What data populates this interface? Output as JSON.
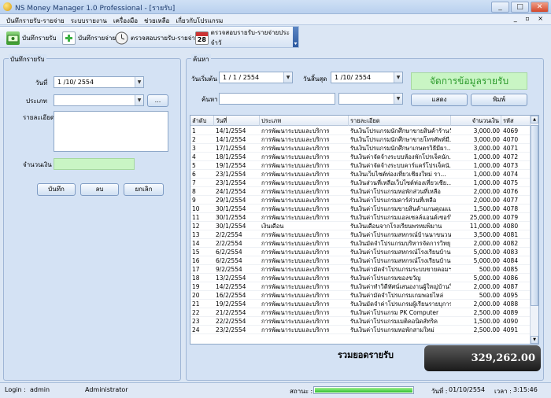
{
  "window": {
    "title": "NS Money Manager 1.0 Professional - [รายรับ]",
    "min": "_",
    "max": "□",
    "close": "✕",
    "mdi_controls": "_ ▫ ×"
  },
  "menu": [
    "บันทึกรายรับ-รายจ่าย",
    "ระบบรายงาน",
    "เครื่องมือ",
    "ช่วยเหลือ",
    "เกี่ยวกับโปรแกรม"
  ],
  "toolbar": {
    "income": "บันทึกรายรับ",
    "expense": "บันทึกรายจ่าย",
    "check": "ตรวจสอบรายรับ-รายจ่าย",
    "check_daily": "ตรวจสอบรายรับ-รายจ่ายประจำวั",
    "calendar_day": "28"
  },
  "left": {
    "panel_title": "บันทึกรายรับ",
    "date_label": "วันที่",
    "date_value": "1 /10/ 2554",
    "type_label": "ประเภท",
    "type_value": "",
    "browse": "...",
    "detail_label": "รายละเอียด",
    "detail_value": "",
    "amount_label": "จำนวนเงิน",
    "amount_value": "",
    "save": "บันทึก",
    "delete": "ลบ",
    "cancel": "ยกเลิก"
  },
  "search": {
    "panel_title": "ค้นหา",
    "start_label": "วันเริ่มต้น",
    "start_value": "1 / 1 / 2554",
    "end_label": "วันสิ้นสุด",
    "end_value": "1 /10/ 2554",
    "manage": "จัดการข้อมูลรายรับ",
    "keyword_label": "ค้นหา",
    "keyword_value": "",
    "filter_value": "",
    "show": "แสดง",
    "print": "พิมพ์"
  },
  "grid": {
    "headers": [
      "ลำดับ",
      "วันที่",
      "ประเภท",
      "รายละเอียด",
      "จำนวนเงิน",
      "รหัส"
    ],
    "rows": [
      [
        "1",
        "14/1/2554",
        "การพัฒนาระบบและบริการ",
        "รับเงินโปรแกรมนักศึกษาขายสินค้าร้านวั...",
        "3,000.00",
        "4069"
      ],
      [
        "2",
        "14/1/2554",
        "การพัฒนาระบบและบริการ",
        "รับเงินโปรแกรมนักศึกษาขายโทรศัพท์มื...",
        "3,000.00",
        "4070"
      ],
      [
        "3",
        "17/1/2554",
        "การพัฒนาระบบและบริการ",
        "รับเงินโปรแกรมนักศึกษาเกษตรวิธีมีผา...",
        "3,000.00",
        "4071"
      ],
      [
        "4",
        "18/1/2554",
        "การพัฒนาระบบและบริการ",
        "รับเงินค่าจัดจ้างระบบห้องพักโปรเจ็คนัก...",
        "1,000.00",
        "4072"
      ],
      [
        "5",
        "19/1/2554",
        "การพัฒนาระบบและบริการ",
        "รับเงินค่าจัดจ้างระบบคาร์แคร์โปรเจ็คนั...",
        "1,000.00",
        "4073"
      ],
      [
        "6",
        "23/1/2554",
        "การพัฒนาระบบและบริการ",
        "รับเงินเว็บไซต์ท่องเที่ยวเชียงใหม่ รา...",
        "1,000.00",
        "4074"
      ],
      [
        "7",
        "23/1/2554",
        "การพัฒนาระบบและบริการ",
        "รับเงินส่วนที่เหลือเว็บไซต์ท่องเที่ยวเชีย...",
        "1,000.00",
        "4075"
      ],
      [
        "8",
        "24/1/2554",
        "การพัฒนาระบบและบริการ",
        "รับเงินค่าโปรแกรมหอพักส่วนที่เหลือ",
        "2,000.00",
        "4076"
      ],
      [
        "9",
        "29/1/2554",
        "การพัฒนาระบบและบริการ",
        "รับเงินค่าโปรแกรมคาร์ส่วนที่เหลือ",
        "2,000.00",
        "4077"
      ],
      [
        "10",
        "30/1/2554",
        "การพัฒนาระบบและบริการ",
        "รับเงินค่าโปรแกรมขายสินค้าแกนคุณแม่...",
        "1,500.00",
        "4078"
      ],
      [
        "11",
        "30/1/2554",
        "การพัฒนาระบบและบริการ",
        "รับเงินค่าโปรแกรมแอลเซลล์แอนด์เซอร์วิส",
        "25,000.00",
        "4079"
      ],
      [
        "12",
        "30/1/2554",
        "เงินเดือน",
        "รับเงินเดือนจากโรงเรียนพรหมพิมาน",
        "11,000.00",
        "4080"
      ],
      [
        "13",
        "2/2/2554",
        "การพัฒนาระบบและบริการ",
        "รับเงินค่าโปรแกรมสหกรณ์บ้านนาขนวน",
        "3,500.00",
        "4081"
      ],
      [
        "14",
        "2/2/2554",
        "การพัฒนาระบบและบริการ",
        "รับเงินมัดจำโปรแกรมบริหารจัดการวิทยุ",
        "2,000.00",
        "4082"
      ],
      [
        "15",
        "6/2/2554",
        "การพัฒนาระบบและบริการ",
        "รับเงินค่าโปรแกรมสหกรณ์โรงเรียนบ้าน...",
        "5,000.00",
        "4083"
      ],
      [
        "16",
        "6/2/2554",
        "การพัฒนาระบบและบริการ",
        "รับเงินค่าโปรแกรมสหกรณ์โรงเรียนบ้าน...",
        "5,000.00",
        "4084"
      ],
      [
        "17",
        "9/2/2554",
        "การพัฒนาระบบและบริการ",
        "รับเงินค่ามัดจำโปรแกรมระบบขายคอมฯ",
        "500.00",
        "4085"
      ],
      [
        "18",
        "13/2/2554",
        "การพัฒนาระบบและบริการ",
        "รับเงินค่าโปรแกรมของขวัญ",
        "5,000.00",
        "4086"
      ],
      [
        "19",
        "14/2/2554",
        "การพัฒนาระบบและบริการ",
        "รับเงินค่าทำวิดีทัศน์เสนองานผู้ใหญ่บ้านวิธุ์...",
        "2,000.00",
        "4087"
      ],
      [
        "20",
        "16/2/2554",
        "การพัฒนาระบบและบริการ",
        "รับเงินค่ามัดจำโปรแกรมเกมพอยไหล่",
        "500.00",
        "4095"
      ],
      [
        "21",
        "19/2/2554",
        "การพัฒนาระบบและบริการ",
        "รับเงินมัดจำค่าโปรแกรมผู้เรียนรายบุการ...",
        "2,000.00",
        "4088"
      ],
      [
        "22",
        "21/2/2554",
        "การพัฒนาระบบและบริการ",
        "รับเงินค่าโปรแกรม PK Computer",
        "2,500.00",
        "4089"
      ],
      [
        "23",
        "22/2/2554",
        "การพัฒนาระบบและบริการ",
        "รับเงินค่าโปรแกรมเมติคอนิดส์ทริค",
        "1,500.00",
        "4090"
      ],
      [
        "24",
        "23/2/2554",
        "การพัฒนาระบบและบริการ",
        "รับเงินค่าโปรแกรมหอพักสามใหม่",
        "2,500.00",
        "4091"
      ]
    ]
  },
  "total": {
    "label": "รวมยอดรายรับ",
    "value": "329,262.00"
  },
  "status": {
    "login_label": "Login :",
    "login_user": "admin",
    "role": "Administrator",
    "state_label": "สถานะ :",
    "progress": 1.0,
    "date_label": "วันที่ :",
    "date": "01/10/2554",
    "time_label": "เวลา :",
    "time": "3:15:46"
  },
  "colors": {
    "accent": "#2d5aa0",
    "manage_bg": "#c9f5c4",
    "manage_fg": "#2d9b2d",
    "progress": "#2fbf2f"
  }
}
